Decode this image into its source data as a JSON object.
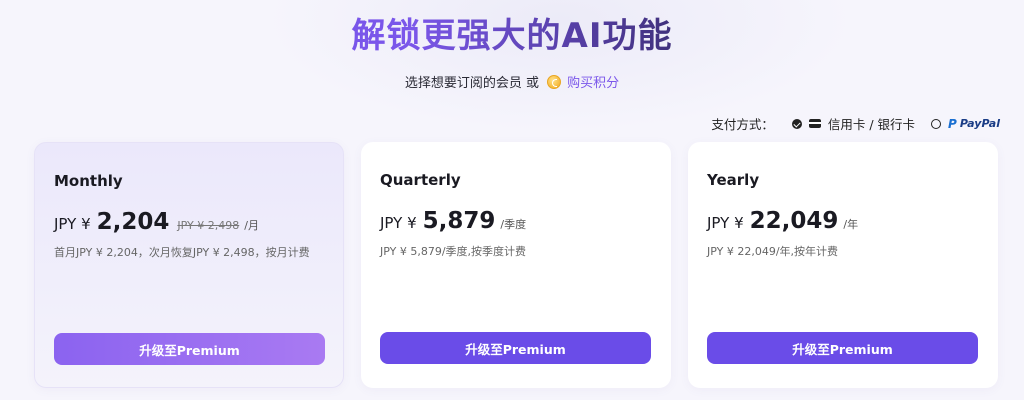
{
  "header": {
    "title": "解锁更强大的AI功能",
    "subtitle": "选择想要订阅的会员 或",
    "buy_credits": "购买积分"
  },
  "payment": {
    "label": "支付方式：",
    "options": [
      {
        "label": "信用卡 / 银行卡",
        "selected": true,
        "icon": "credit-card-icon"
      },
      {
        "label": "PayPal",
        "selected": false,
        "icon": "paypal-logo"
      }
    ]
  },
  "plans": [
    {
      "name": "Monthly",
      "currency": "JPY ¥",
      "amount": "2,204",
      "old_price": "JPY ¥ 2,498",
      "period": "/月",
      "description": "首月JPY ¥ 2,204，次月恢复JPY ¥ 2,498，按月计费",
      "button": "升级至Premium",
      "selected": true
    },
    {
      "name": "Quarterly",
      "currency": "JPY ¥",
      "amount": "5,879",
      "old_price": "",
      "period": "/季度",
      "description": "JPY ¥ 5,879/季度,按季度计费",
      "button": "升级至Premium",
      "selected": false
    },
    {
      "name": "Yearly",
      "currency": "JPY ¥",
      "amount": "22,049",
      "old_price": "",
      "period": "/年",
      "description": "JPY ¥ 22,049/年,按年计费",
      "button": "升级至Premium",
      "selected": false
    }
  ],
  "colors": {
    "accent": "#6a4ce8",
    "accent_light": "#a97af2",
    "background": "#f6f5fc"
  }
}
